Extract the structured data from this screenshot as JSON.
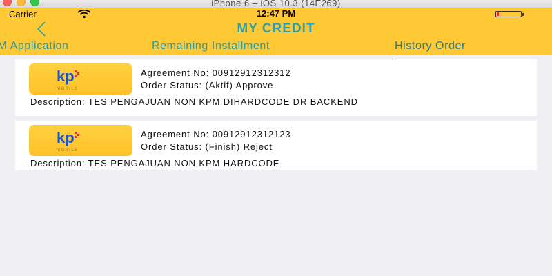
{
  "window": {
    "title": "iPhone 6 – iOS 10.3 (14E269)"
  },
  "status_bar": {
    "carrier": "Carrier",
    "time": "12:47 PM"
  },
  "header": {
    "title": "MY CREDIT",
    "tabs": [
      {
        "label": "KPM Application",
        "active": false
      },
      {
        "label": "Remaining Installment",
        "active": false
      },
      {
        "label": "History Order",
        "active": true
      }
    ]
  },
  "orders": [
    {
      "logo_text": "kp",
      "logo_sub": "MOBILE",
      "agreement_label": "Agreement No:",
      "agreement_no": "00912912312312",
      "status_label": "Order Status:",
      "status_value": "(Aktif) Approve",
      "description_label": "Description:",
      "description": "TES PENGAJUAN NON KPM DIHARDCODE DR BACKEND"
    },
    {
      "logo_text": "kp",
      "logo_sub": "MOBILE",
      "agreement_label": "Agreement No:",
      "agreement_no": "00912912312123",
      "status_label": "Order Status:",
      "status_value": "(Finish) Reject",
      "description_label": "Description:",
      "description": "TES PENGAJUAN NON KPM HARDCODE"
    }
  ],
  "colors": {
    "header_bg": "#ffc936",
    "accent_teal": "#2f9fa7",
    "tab_underline": "#d8324a",
    "page_bg": "#efeff4"
  },
  "icons": {
    "back": "chevron-left-icon",
    "wifi": "wifi-icon",
    "battery": "battery-icon"
  }
}
